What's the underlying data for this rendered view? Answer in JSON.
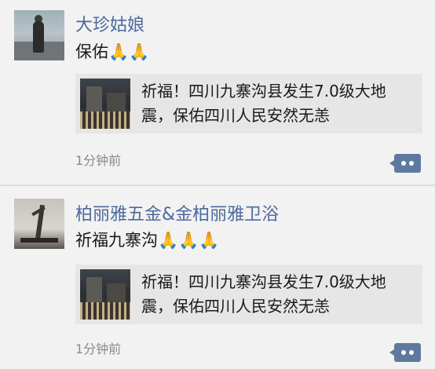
{
  "posts": [
    {
      "author": "大珍姑娘",
      "message": "保佑🙏🙏",
      "shared_title": "祈福！四川九寨沟县发生7.0级大地震，保佑四川人民安然无恙",
      "time": "1分钟前"
    },
    {
      "author": "柏丽雅五金&金柏丽雅卫浴",
      "message": "祈福九寨沟🙏🙏🙏",
      "shared_title": "祈福！四川九寨沟县发生7.0级大地震，保佑四川人民安然无恙",
      "time": "1分钟前"
    }
  ],
  "colors": {
    "author_name": "#4d6a9c",
    "comment_button": "#5d7a9e",
    "share_card_bg": "#e6e6e6",
    "time_text": "#8a8a8a"
  },
  "icons": {
    "comment": "more-comment-icon"
  }
}
